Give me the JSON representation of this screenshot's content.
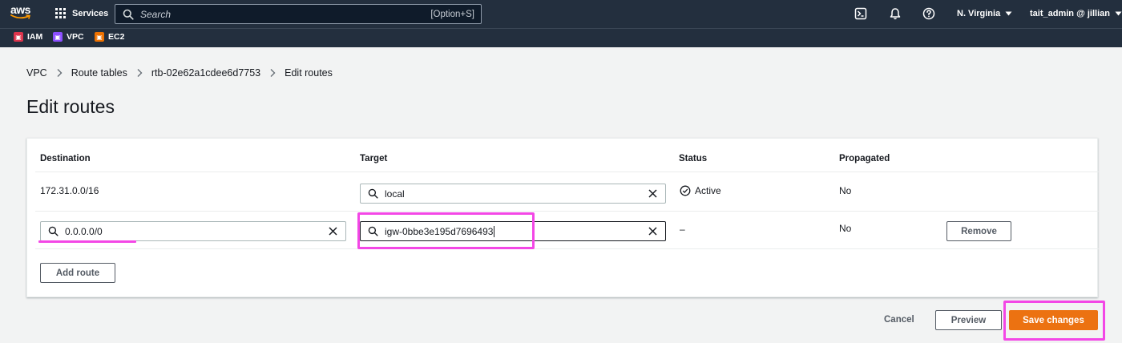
{
  "topnav": {
    "logo_text": "aws",
    "services_label": "Services",
    "search_placeholder": "Search",
    "search_shortcut": "[Option+S]",
    "region": "N. Virginia",
    "account": "tait_admin @ jillian"
  },
  "favorites": [
    {
      "label": "IAM",
      "color": "#dd344c"
    },
    {
      "label": "VPC",
      "color": "#8c4fff"
    },
    {
      "label": "EC2",
      "color": "#ed7100"
    }
  ],
  "breadcrumb": [
    "VPC",
    "Route tables",
    "rtb-02e62a1cdee6d7753",
    "Edit routes"
  ],
  "page_title": "Edit routes",
  "table": {
    "headers": {
      "destination": "Destination",
      "target": "Target",
      "status": "Status",
      "propagated": "Propagated"
    },
    "rows": [
      {
        "destination": "172.31.0.0/16",
        "target": "local",
        "status": "Active",
        "propagated": "No"
      },
      {
        "destination": "0.0.0.0/0",
        "target": "igw-0bbe3e195d7696493",
        "status": "–",
        "propagated": "No",
        "remove_label": "Remove"
      }
    ],
    "add_route_label": "Add route"
  },
  "actions": {
    "cancel": "Cancel",
    "preview": "Preview",
    "save": "Save changes"
  },
  "colors": {
    "nav_bg": "#232f3e",
    "primary": "#ec7211",
    "highlight": "#f347e6",
    "success": "#1d8102"
  }
}
